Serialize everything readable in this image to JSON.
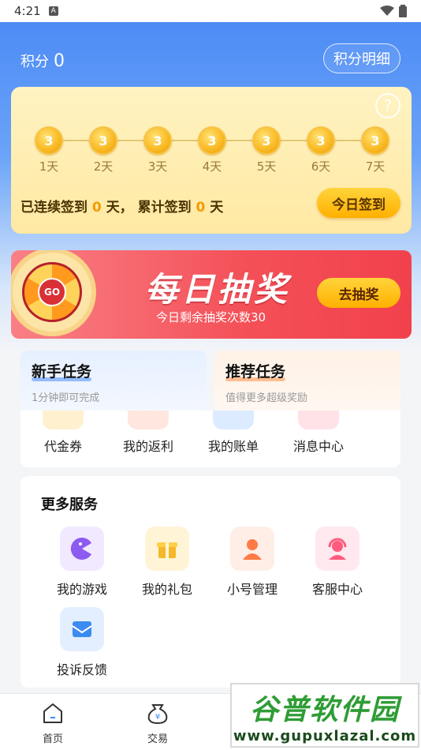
{
  "status_bar": {
    "time": "4:21",
    "notif_letter": "A"
  },
  "points": {
    "label": "积分",
    "value": "0",
    "detail_button": "积分明细"
  },
  "signin": {
    "coin_value": "3",
    "days": [
      "1天",
      "2天",
      "3天",
      "4天",
      "5天",
      "6天",
      "7天"
    ],
    "stats_prefix": "已连续签到",
    "continuous_days": "0",
    "stats_mid": "天， 累计签到",
    "total_days": "0",
    "stats_suffix": "天",
    "button": "今日签到",
    "help_glyph": "?"
  },
  "lottery": {
    "title": "每日抽奖",
    "subtitle": "今日剩余抽奖次数30",
    "button": "去抽奖",
    "wheel_center": "GO"
  },
  "tasks": [
    {
      "title": "新手任务",
      "subtitle": "1分钟即可完成"
    },
    {
      "title": "推荐任务",
      "subtitle": "值得更多超级奖励"
    }
  ],
  "tools": [
    {
      "label": "代金券",
      "icon": "voucher-icon",
      "color": "#fff5dc"
    },
    {
      "label": "我的返利",
      "icon": "rebate-icon",
      "color": "#fff0ec"
    },
    {
      "label": "我的账单",
      "icon": "bill-icon",
      "color": "#e7f1ff"
    },
    {
      "label": "消息中心",
      "icon": "message-icon",
      "color": "#ffecef"
    }
  ],
  "services": {
    "title": "更多服务",
    "items": [
      {
        "label": "我的游戏",
        "icon": "game-icon",
        "color": "#f3ecff"
      },
      {
        "label": "我的礼包",
        "icon": "gift-icon",
        "color": "#fff6dd"
      },
      {
        "label": "小号管理",
        "icon": "account-icon",
        "color": "#fff0ea"
      },
      {
        "label": "客服中心",
        "icon": "customer-service-icon",
        "color": "#ffeef1"
      },
      {
        "label": "投诉反馈",
        "icon": "feedback-icon",
        "color": "#e8f2ff"
      }
    ]
  },
  "bottom_nav": [
    {
      "label": "首页",
      "icon": "home-icon"
    },
    {
      "label": "交易",
      "icon": "trade-icon"
    }
  ],
  "watermark": {
    "title": "谷普软件园",
    "url": "www.gupuxlazal.com"
  }
}
